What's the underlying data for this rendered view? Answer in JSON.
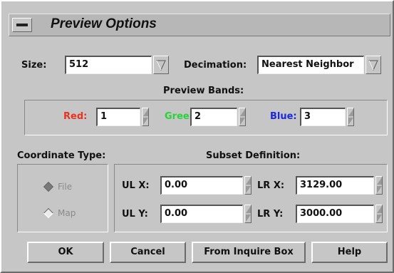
{
  "window": {
    "title": "Preview Options"
  },
  "size": {
    "label": "Size:",
    "value": "512"
  },
  "decimation": {
    "label": "Decimation:",
    "value": "Nearest Neighbor"
  },
  "preview_bands": {
    "heading": "Preview Bands:",
    "red": {
      "label": "Red:",
      "value": "1",
      "color": "#e8331f"
    },
    "green": {
      "label": "Green:",
      "value": "2",
      "color": "#28d33a"
    },
    "blue": {
      "label": "Blue:",
      "value": "3",
      "color": "#1a29e0"
    }
  },
  "coordinate_type": {
    "heading": "Coordinate Type:",
    "options": [
      {
        "label": "File",
        "selected": true
      },
      {
        "label": "Map",
        "selected": false
      }
    ]
  },
  "subset": {
    "heading": "Subset Definition:",
    "ulx": {
      "label": "UL X:",
      "value": "0.00"
    },
    "uly": {
      "label": "UL Y:",
      "value": "0.00"
    },
    "lrx": {
      "label": "LR X:",
      "value": "3129.00"
    },
    "lry": {
      "label": "LR Y:",
      "value": "3000.00"
    }
  },
  "buttons": {
    "ok": "OK",
    "cancel": "Cancel",
    "inquire": "From Inquire Box",
    "help": "Help"
  }
}
